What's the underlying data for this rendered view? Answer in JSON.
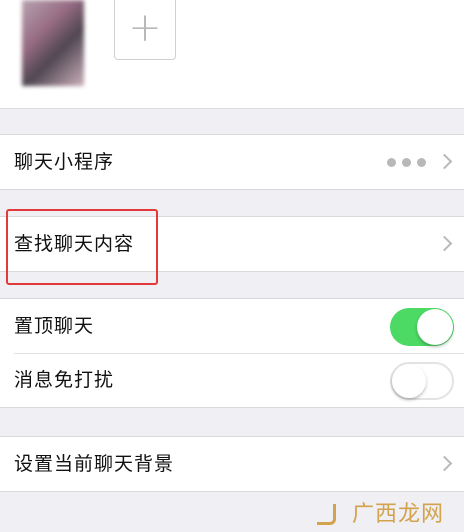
{
  "header": {
    "add_symbol": "+"
  },
  "rows": {
    "mini_programs": {
      "label": "聊天小程序",
      "more_icon": "ellipsis-icon"
    },
    "search_chat": {
      "label": "查找聊天内容"
    },
    "pin_chat": {
      "label": "置顶聊天",
      "toggle_on": true
    },
    "mute": {
      "label": "消息免打扰",
      "toggle_on": false
    },
    "background": {
      "label": "设置当前聊天背景"
    }
  },
  "colors": {
    "toggle_on": "#4cd964",
    "highlight": "#e23a3a",
    "background": "#efeff4"
  },
  "watermark": {
    "text": "广西龙网"
  }
}
